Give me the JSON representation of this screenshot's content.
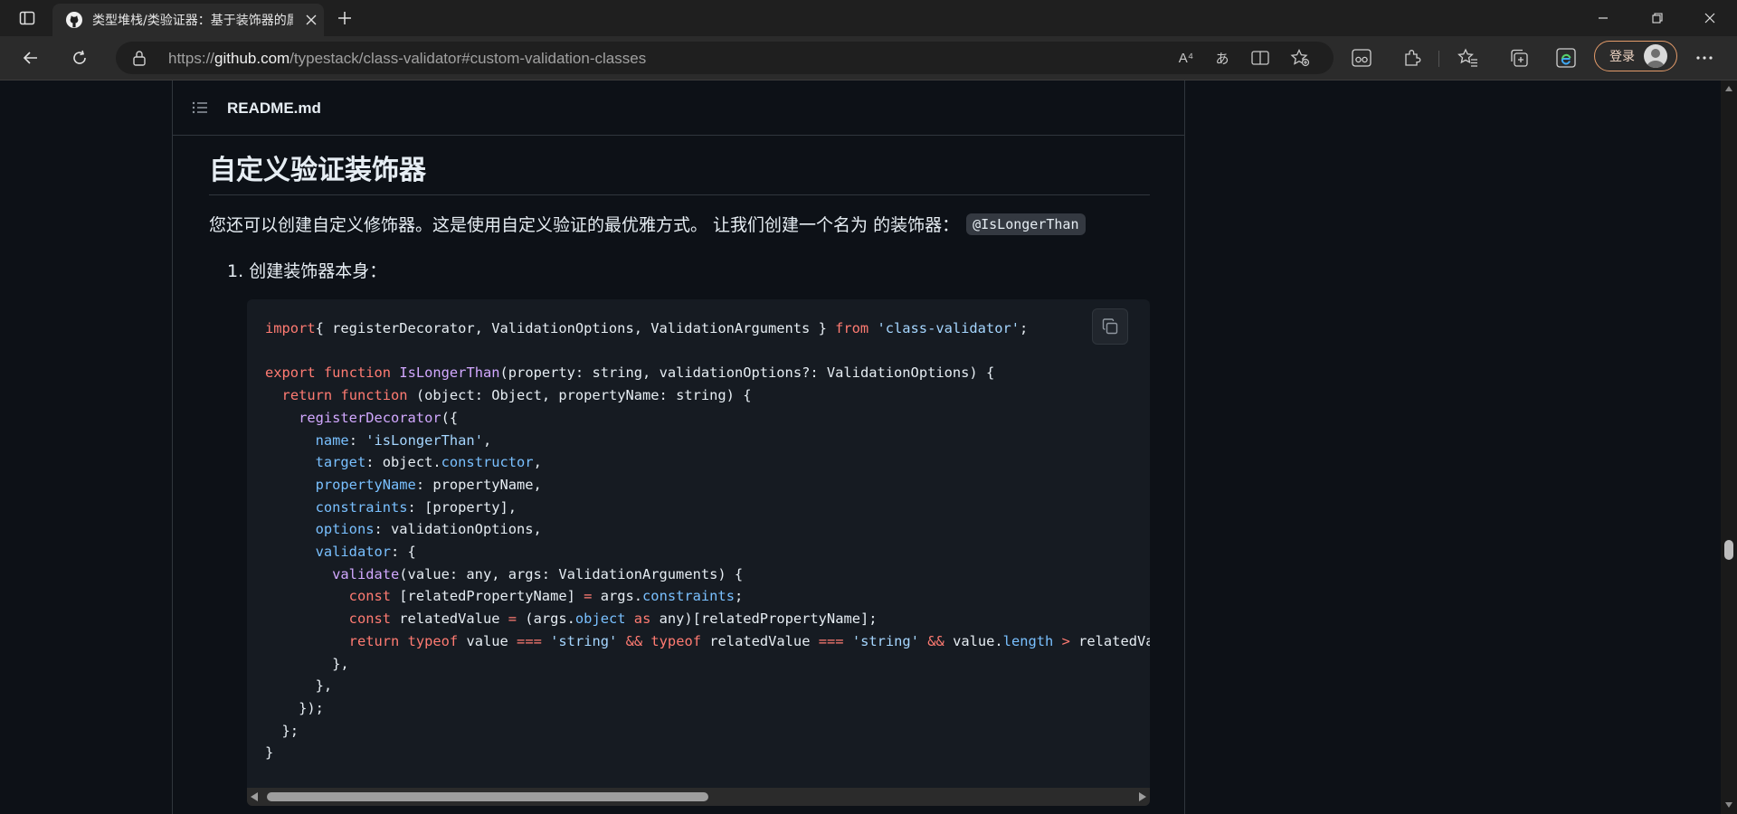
{
  "browser": {
    "tab_title": "类型堆栈/类验证器：基于装饰器的属性验证",
    "url_scheme": "https://",
    "url_host": "github.com",
    "url_path": "/typestack/class-validator#custom-validation-classes",
    "read_aloud_icon_text": "A⁴",
    "translate_icon_text": "あ",
    "login_label": "登录"
  },
  "readme": {
    "file_name": "README.md",
    "heading": "自定义验证装饰器",
    "paragraph": "您还可以创建自定义修饰器。这是使用自定义验证的最优雅方式。 让我们创建一个名为 的装饰器：",
    "inline_code": "@IsLongerThan",
    "list_number": "1.",
    "list_text": "创建装饰器本身："
  },
  "code_lines": [
    [
      [
        "k",
        "import"
      ],
      [
        "",
        "{ registerDecorator, ValidationOptions, ValidationArguments } "
      ],
      [
        "k",
        "from"
      ],
      [
        "",
        " "
      ],
      [
        "s",
        "'class-validator'"
      ],
      [
        "",
        ";"
      ]
    ],
    [],
    [
      [
        "k",
        "export"
      ],
      [
        "",
        " "
      ],
      [
        "k",
        "function"
      ],
      [
        "",
        " "
      ],
      [
        "f",
        "IsLongerThan"
      ],
      [
        "",
        "(property: string, validationOptions?: ValidationOptions) {"
      ]
    ],
    [
      [
        "",
        "  "
      ],
      [
        "k",
        "return"
      ],
      [
        "",
        " "
      ],
      [
        "k",
        "function"
      ],
      [
        "",
        " (object: Object, propertyName: string) {"
      ]
    ],
    [
      [
        "",
        "    "
      ],
      [
        "f",
        "registerDecorator"
      ],
      [
        "",
        "({"
      ]
    ],
    [
      [
        "",
        "      "
      ],
      [
        "p",
        "name"
      ],
      [
        "",
        ": "
      ],
      [
        "s",
        "'isLongerThan'"
      ],
      [
        "",
        ","
      ]
    ],
    [
      [
        "",
        "      "
      ],
      [
        "p",
        "target"
      ],
      [
        "",
        ": object."
      ],
      [
        "p",
        "constructor"
      ],
      [
        "",
        ","
      ]
    ],
    [
      [
        "",
        "      "
      ],
      [
        "p",
        "propertyName"
      ],
      [
        "",
        ": propertyName,"
      ]
    ],
    [
      [
        "",
        "      "
      ],
      [
        "p",
        "constraints"
      ],
      [
        "",
        ": [property],"
      ]
    ],
    [
      [
        "",
        "      "
      ],
      [
        "p",
        "options"
      ],
      [
        "",
        ": validationOptions,"
      ]
    ],
    [
      [
        "",
        "      "
      ],
      [
        "p",
        "validator"
      ],
      [
        "",
        ": {"
      ]
    ],
    [
      [
        "",
        "        "
      ],
      [
        "f",
        "validate"
      ],
      [
        "",
        "(value: any, args: ValidationArguments) {"
      ]
    ],
    [
      [
        "",
        "          "
      ],
      [
        "k",
        "const"
      ],
      [
        "",
        " [relatedPropertyName] "
      ],
      [
        "k",
        "="
      ],
      [
        "",
        " args."
      ],
      [
        "p",
        "constraints"
      ],
      [
        "",
        ";"
      ]
    ],
    [
      [
        "",
        "          "
      ],
      [
        "k",
        "const"
      ],
      [
        "",
        " relatedValue "
      ],
      [
        "k",
        "="
      ],
      [
        "",
        " (args."
      ],
      [
        "p",
        "object"
      ],
      [
        "",
        " "
      ],
      [
        "k",
        "as"
      ],
      [
        "",
        " any)[relatedPropertyName];"
      ]
    ],
    [
      [
        "",
        "          "
      ],
      [
        "k",
        "return"
      ],
      [
        "",
        " "
      ],
      [
        "k",
        "typeof"
      ],
      [
        "",
        " value "
      ],
      [
        "k",
        "==="
      ],
      [
        "",
        " "
      ],
      [
        "s",
        "'string'"
      ],
      [
        "",
        " "
      ],
      [
        "k",
        "&&"
      ],
      [
        "",
        " "
      ],
      [
        "k",
        "typeof"
      ],
      [
        "",
        " relatedValue "
      ],
      [
        "k",
        "==="
      ],
      [
        "",
        " "
      ],
      [
        "s",
        "'string'"
      ],
      [
        "",
        " "
      ],
      [
        "k",
        "&&"
      ],
      [
        "",
        " value."
      ],
      [
        "p",
        "length"
      ],
      [
        "",
        " "
      ],
      [
        "k",
        ">"
      ],
      [
        "",
        " relatedValue.length;"
      ]
    ],
    [
      [
        "",
        "        },"
      ]
    ],
    [
      [
        "",
        "      },"
      ]
    ],
    [
      [
        "",
        "    });"
      ]
    ],
    [
      [
        "",
        "  };"
      ]
    ],
    [
      [
        "",
        "}"
      ]
    ]
  ],
  "colors": {
    "keyword": "#ff7b72",
    "string": "#a5d6ff",
    "function": "#d2a8ff",
    "property": "#79c0ff",
    "page_bg": "#0d1117",
    "code_bg": "#161b22"
  }
}
